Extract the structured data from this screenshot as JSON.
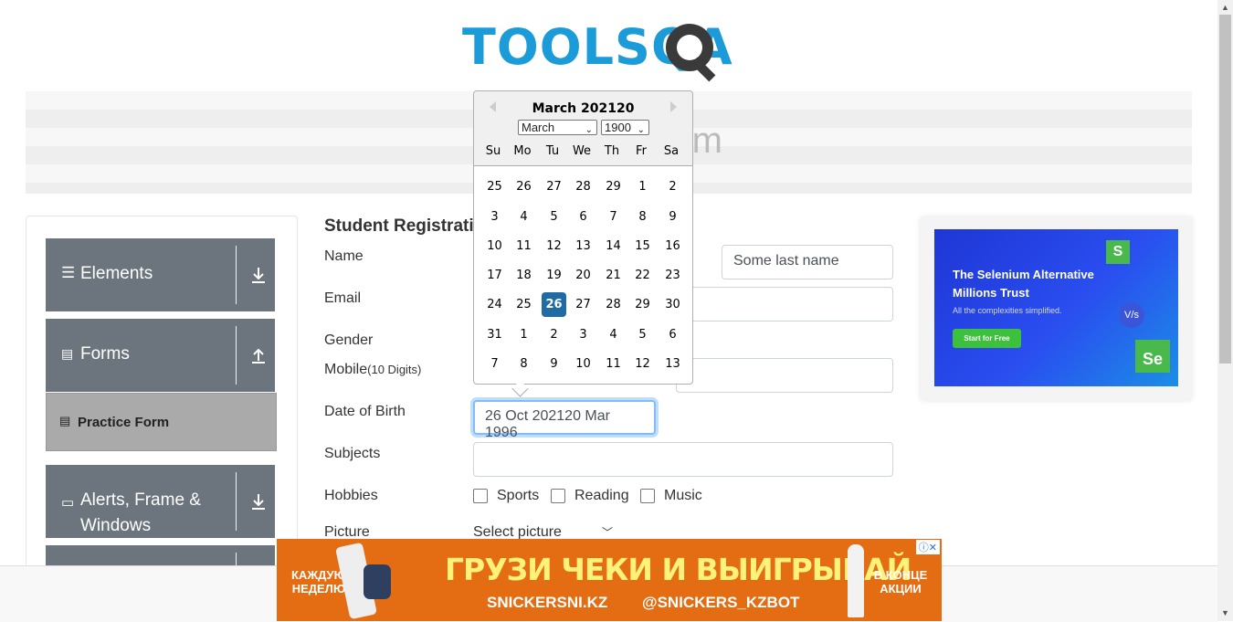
{
  "header": {
    "logo_text": "TOOLSQA",
    "banner_title": "Practice Form"
  },
  "sidebar": {
    "groups": [
      {
        "label": "Elements",
        "icon": "hamburger-icon",
        "arrow": "download-arrow-icon"
      },
      {
        "label": "Forms",
        "icon": "document-icon",
        "arrow": "upload-arrow-icon"
      },
      {
        "label": "Alerts, Frame &",
        "label2": "Windows",
        "icon": "window-icon",
        "arrow": "download-arrow-icon"
      }
    ],
    "practice_form": "Practice Form"
  },
  "form": {
    "title": "Student Registration Form",
    "name_label": "Name",
    "last_name_value": "Some last name",
    "email_label": "Email",
    "gender_label": "Gender",
    "mobile_label": "Mobile",
    "mobile_hint": "(10 Digits)",
    "dob_label": "Date of Birth",
    "dob_value": "26 Oct 202120 Mar 1996",
    "subjects_label": "Subjects",
    "hobbies_label": "Hobbies",
    "hobbies": [
      "Sports",
      "Reading",
      "Music"
    ],
    "picture_label": "Picture",
    "picture_select": "Select picture"
  },
  "calendar": {
    "title": "March 202120",
    "month_select": "March",
    "year_select": "1900",
    "day_names": [
      "Su",
      "Mo",
      "Tu",
      "We",
      "Th",
      "Fr",
      "Sa"
    ],
    "weeks": [
      [
        "25",
        "26",
        "27",
        "28",
        "29",
        "1",
        "2"
      ],
      [
        "3",
        "4",
        "5",
        "6",
        "7",
        "8",
        "9"
      ],
      [
        "10",
        "11",
        "12",
        "13",
        "14",
        "15",
        "16"
      ],
      [
        "17",
        "18",
        "19",
        "20",
        "21",
        "22",
        "23"
      ],
      [
        "24",
        "25",
        "26",
        "27",
        "28",
        "29",
        "30"
      ],
      [
        "31",
        "1",
        "2",
        "3",
        "4",
        "5",
        "6"
      ],
      [
        "7",
        "8",
        "9",
        "10",
        "11",
        "12",
        "13"
      ]
    ],
    "selected_day": "26"
  },
  "ads": {
    "right": {
      "headline": "The Selenium Alternative Millions Trust",
      "sub": "All the complexities simplified.",
      "button": "Start for Free",
      "s_logo": "S",
      "se_logo": "Se",
      "vs": "V/s"
    },
    "bottom": {
      "headline": "ГРУЗИ ЧЕКИ И ВЫИГРЫВАЙ",
      "site": "SNICKERSNI.KZ",
      "bot": "@SNICKERS_KZBOT",
      "left_text": "КАЖДУЮ НЕДЕЛЮ",
      "right_text": "В КОНЦЕ АКЦИИ",
      "ad_marker": "ⓘ✕"
    }
  },
  "colors": {
    "brand_blue": "#1b9bd7",
    "sidebar_gray": "#6c757d",
    "selected_day": "#216ba5",
    "focus_border": "#80bdff"
  }
}
